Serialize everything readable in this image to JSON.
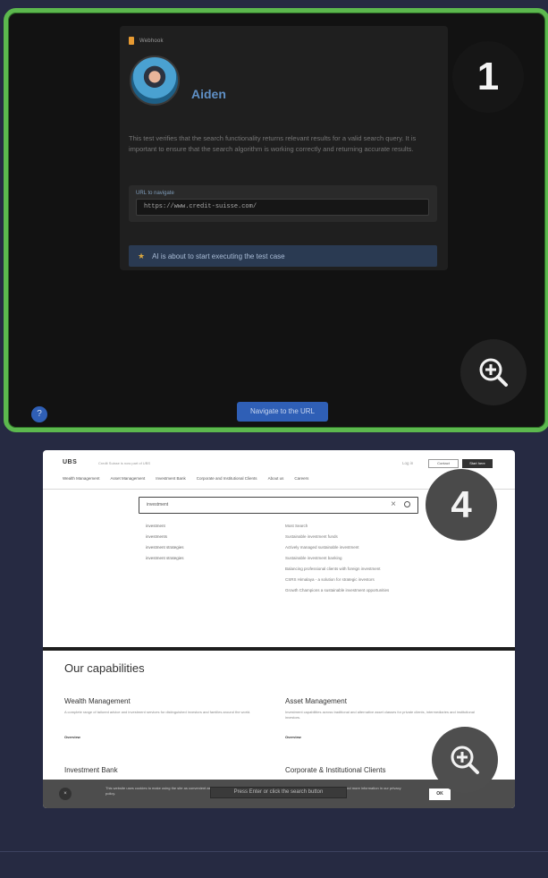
{
  "card1": {
    "agent_badge": "Webhook",
    "agent_name": "Aiden",
    "description": "This test verifies that the search functionality returns relevant results for a valid search query. It is important to ensure that the search algorithm is working correctly and returning accurate results.",
    "url_label": "URL to navigate",
    "url_value": "https://www.credit-suisse.com/",
    "status_text": "AI is about to start executing the test case",
    "navigate_label": "Navigate to the URL",
    "help_label": "?",
    "step_number": "1"
  },
  "card2": {
    "step_number": "4",
    "header": {
      "logo": "UBS",
      "logo_sub": "Credit Suisse is now part of UBS",
      "login": "Log in",
      "contact": "Contact",
      "start": "Start here"
    },
    "nav": [
      "Wealth Management",
      "Asset Management",
      "Investment Bank",
      "Corporate and Institutional Clients",
      "About us",
      "Careers"
    ],
    "search_value": "investment",
    "suggestions_left": [
      "investment",
      "investments",
      "investment strategies",
      "investment strategies"
    ],
    "suggestions_right": [
      "Most Search",
      "Sustainable investment funds",
      "Actively managed sustainable investment",
      "Sustainable investment banking",
      "Balancing professional clients with foreign investment",
      "CSRS Himalaya - a solution for strategic investors",
      "Growth Champions a sustainable investment opportunities"
    ],
    "capabilities_title": "Our capabilities",
    "capabilities": [
      {
        "title": "Wealth Management",
        "desc": "A complete range of tailored advice and investment services for distinguished investors and families around the world.",
        "link": "Overview"
      },
      {
        "title": "Asset Management",
        "desc": "Investment capabilities across traditional and alternative asset classes for private clients, intermediaries and institutional investors.",
        "link": "Overview"
      },
      {
        "title": "Investment Bank",
        "desc": "",
        "link": ""
      },
      {
        "title": "Corporate & Institutional Clients",
        "desc": "",
        "link": ""
      }
    ],
    "cookie_text": "This website uses cookies to make using the site as convenient as possible. By continuing to use this website you agree to our use of cookies. You can find more information in our privacy policy.",
    "cookie_ok": "OK",
    "tooltip": "Press Enter or click the search button"
  }
}
